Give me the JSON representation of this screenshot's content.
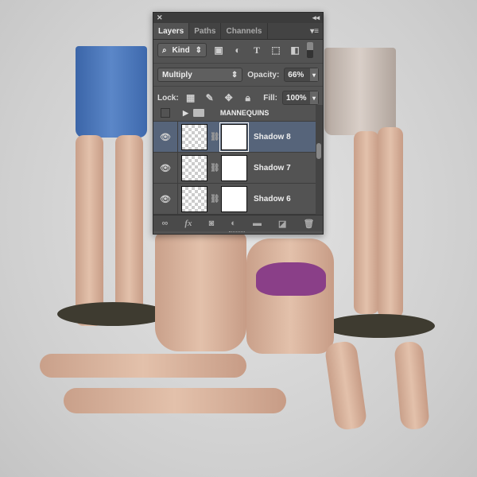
{
  "panel": {
    "close": "✕",
    "collapse": "◂◂",
    "tabs": [
      {
        "label": "Layers"
      },
      {
        "label": "Paths"
      },
      {
        "label": "Channels"
      }
    ],
    "menu": "▾≡",
    "filter": {
      "label": "Kind",
      "icon": "search-icon"
    },
    "blend_mode": "Multiply",
    "opacity_label": "Opacity:",
    "opacity": "66%",
    "lock_label": "Lock:",
    "fill_label": "Fill:",
    "fill": "100%",
    "group": {
      "name": "MANNEQUINS"
    },
    "layers": [
      {
        "name": "Shadow 8",
        "selected": true
      },
      {
        "name": "Shadow 7"
      },
      {
        "name": "Shadow 6"
      }
    ]
  }
}
